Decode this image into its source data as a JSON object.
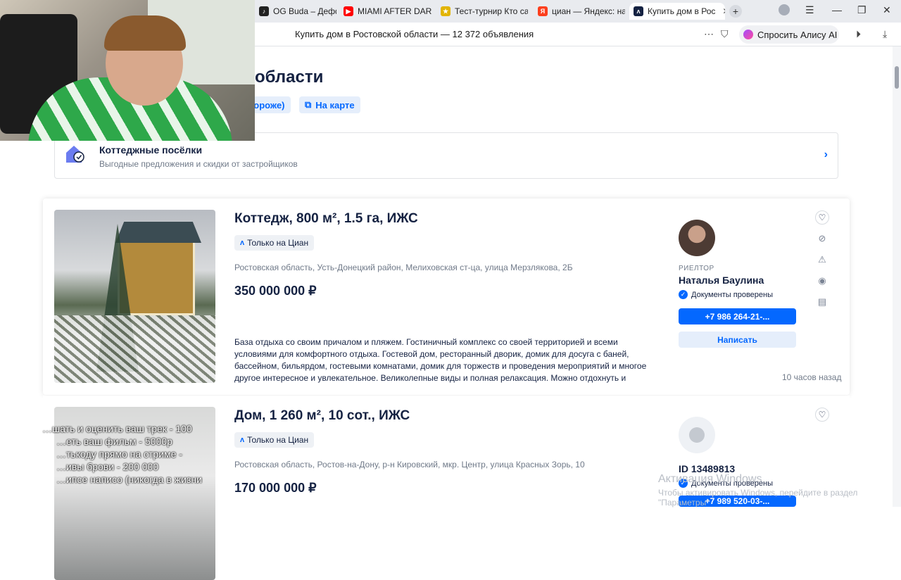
{
  "browser": {
    "tabs": [
      {
        "label": "OG Buda – Дефффч",
        "color": "#222222",
        "fav": "♪"
      },
      {
        "label": "MIAMI AFTER DARK",
        "color": "#ff0000",
        "fav": "▶"
      },
      {
        "label": "Тест-турнир Кто са",
        "color": "#e2b400",
        "fav": "★"
      },
      {
        "label": "циан — Яндекс: наш",
        "color": "#fc3f1d",
        "fav": "Я"
      },
      {
        "label": "Купить дом в Рос",
        "color": "#152242",
        "fav": "ᴧ",
        "active": true
      }
    ],
    "page_title": "Купить дом в Ростовской области — 12 372 объявления",
    "alice_label": "Спросить Алису AI"
  },
  "page": {
    "heading": "области",
    "chips": [
      {
        "label": "дороже)",
        "icon": "sort-icon"
      },
      {
        "label": "На карте",
        "icon": "map-icon"
      }
    ],
    "villages": {
      "title": "Коттеджные посёлки",
      "subtitle": "Выгодные предложения и скидки от застройщиков"
    }
  },
  "listings": [
    {
      "title": "Коттедж, 800 м², 1.5 га, ИЖС",
      "badge": "Только на Циан",
      "address": "Ростовская область, Усть-Донецкий район, Мелиховская ст-ца, улица Мерзлякова, 2Б",
      "price": "350 000 000 ₽",
      "description": "База отдыха со своим причалом и пляжем. Гостиничный комплекс со своей территорией и всеми условиями для комфортного отдыха. Гостевой дом, ресторанный дворик, домик для досуга с баней, бассейном, бильярдом, гостевыми комнатами, домик для торжеств и проведения мероприятий и многое другое интересное и увлекательное. Великолепные виды и полная релаксация. Можно отдохнуть и телом и душо…",
      "agent_role": "РИЕЛТОР",
      "agent_name": "Наталья Баулина",
      "verified": "Документы проверены",
      "phone": "+7 986 264-21-...",
      "write": "Написать",
      "time": "10 часов назад"
    },
    {
      "title": "Дом, 1 260 м², 10 сот., ИЖС",
      "badge": "Только на Циан",
      "address": "Ростовская область, Ростов-на-Дону, р-н Кировский, мкр. Центр, улица Красных Зорь, 10",
      "price": "170 000 000 ₽",
      "agent_name": "ID 13489813",
      "verified": "Документы проверены",
      "phone": "+7 989 520-03-..."
    }
  ],
  "stream_overlay": [
    "…шать и оценить ваш трек - 100",
    "…еть ваш фильм - 5000р",
    "…тькоду прямо на стриме -",
    "…ивы брови - 200 000",
    "…ипсе написо (никогда в жизни"
  ],
  "watermark": {
    "title": "Активация Windows",
    "subtitle": "Чтобы активировать Windows, перейдите в раздел \"Параметры\""
  }
}
